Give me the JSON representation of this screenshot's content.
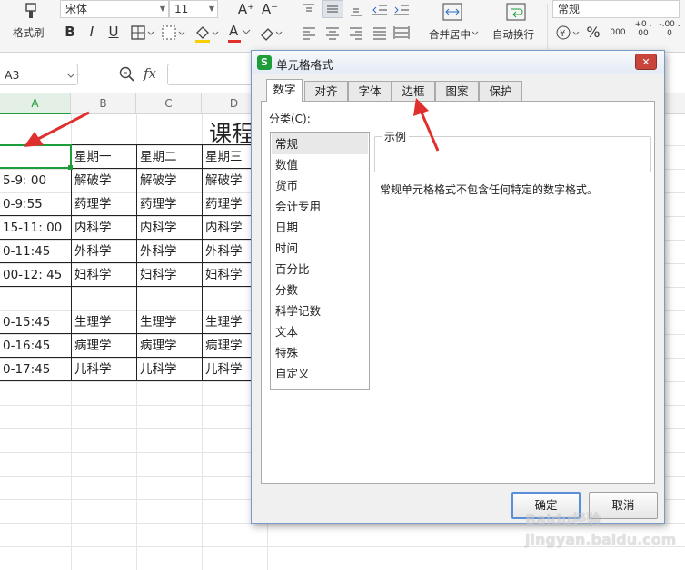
{
  "ribbon": {
    "format_painter_label": "格式刷",
    "font_name": "宋体",
    "font_size": "11",
    "grow_font": "A⁺",
    "shrink_font": "A⁻",
    "bold": "B",
    "italic": "I",
    "underline": "U",
    "strike": "A",
    "font_color": "A",
    "merge_label": "合并居中",
    "wrap_label": "自动换行",
    "number_format": "常规",
    "percent": "%",
    "thousands": "000",
    "inc_decimal": "+0 .00",
    "dec_decimal": "-.00 .0"
  },
  "formula_bar": {
    "name_box": "A3",
    "fx": "fx"
  },
  "sheet": {
    "columns": [
      "A",
      "B",
      "C",
      "D"
    ],
    "title_partial": "课程",
    "rows": [
      [
        "",
        "星期一",
        "星期二",
        "星期三"
      ],
      [
        "5-9: 00",
        "解破学",
        "解破学",
        "解破学"
      ],
      [
        "0-9:55",
        "药理学",
        "药理学",
        "药理学"
      ],
      [
        "15-11: 00",
        "内科学",
        "内科学",
        "内科学"
      ],
      [
        "0-11:45",
        "外科学",
        "外科学",
        "外科学"
      ],
      [
        "00-12: 45",
        "妇科学",
        "妇科学",
        "妇科学"
      ],
      [
        "",
        "",
        "",
        ""
      ],
      [
        "0-15:45",
        "生理学",
        "生理学",
        "生理学"
      ],
      [
        "0-16:45",
        "病理学",
        "病理学",
        "病理学"
      ],
      [
        "0-17:45",
        "儿科学",
        "儿科学",
        "儿科学"
      ]
    ]
  },
  "dialog": {
    "title": "单元格格式",
    "close": "✕",
    "tabs": [
      "数字",
      "对齐",
      "字体",
      "边框",
      "图案",
      "保护"
    ],
    "active_tab": "数字",
    "category_label": "分类(C):",
    "categories": [
      "常规",
      "数值",
      "货币",
      "会计专用",
      "日期",
      "时间",
      "百分比",
      "分数",
      "科学记数",
      "文本",
      "特殊",
      "自定义"
    ],
    "selected_category": "常规",
    "sample_label": "示例",
    "description": "常规单元格格式不包含任何特定的数字格式。",
    "ok_label": "确定",
    "cancel_label": "取消"
  },
  "colors": {
    "accent_green": "#1e9e3a",
    "arrow_red": "#e0302e",
    "dialog_border": "#7b9bc7",
    "close_red": "#c9453c"
  },
  "watermark": "Baidu经验 jingyan.baidu.com"
}
